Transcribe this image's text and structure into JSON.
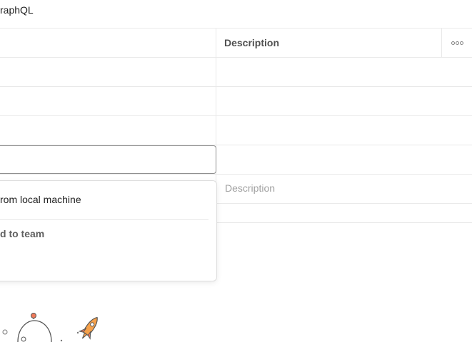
{
  "breadcrumb": {
    "title": "raphQL"
  },
  "table": {
    "columns": [
      "Description"
    ],
    "new_row_description_placeholder": "Description"
  },
  "icons": {
    "more": "more-horizontal-icon"
  },
  "dropdown": {
    "items": [
      {
        "label": "rom local machine"
      },
      {
        "label": "d to team"
      }
    ]
  },
  "illustration": {
    "name": "astronaut-rocket-illustration"
  }
}
